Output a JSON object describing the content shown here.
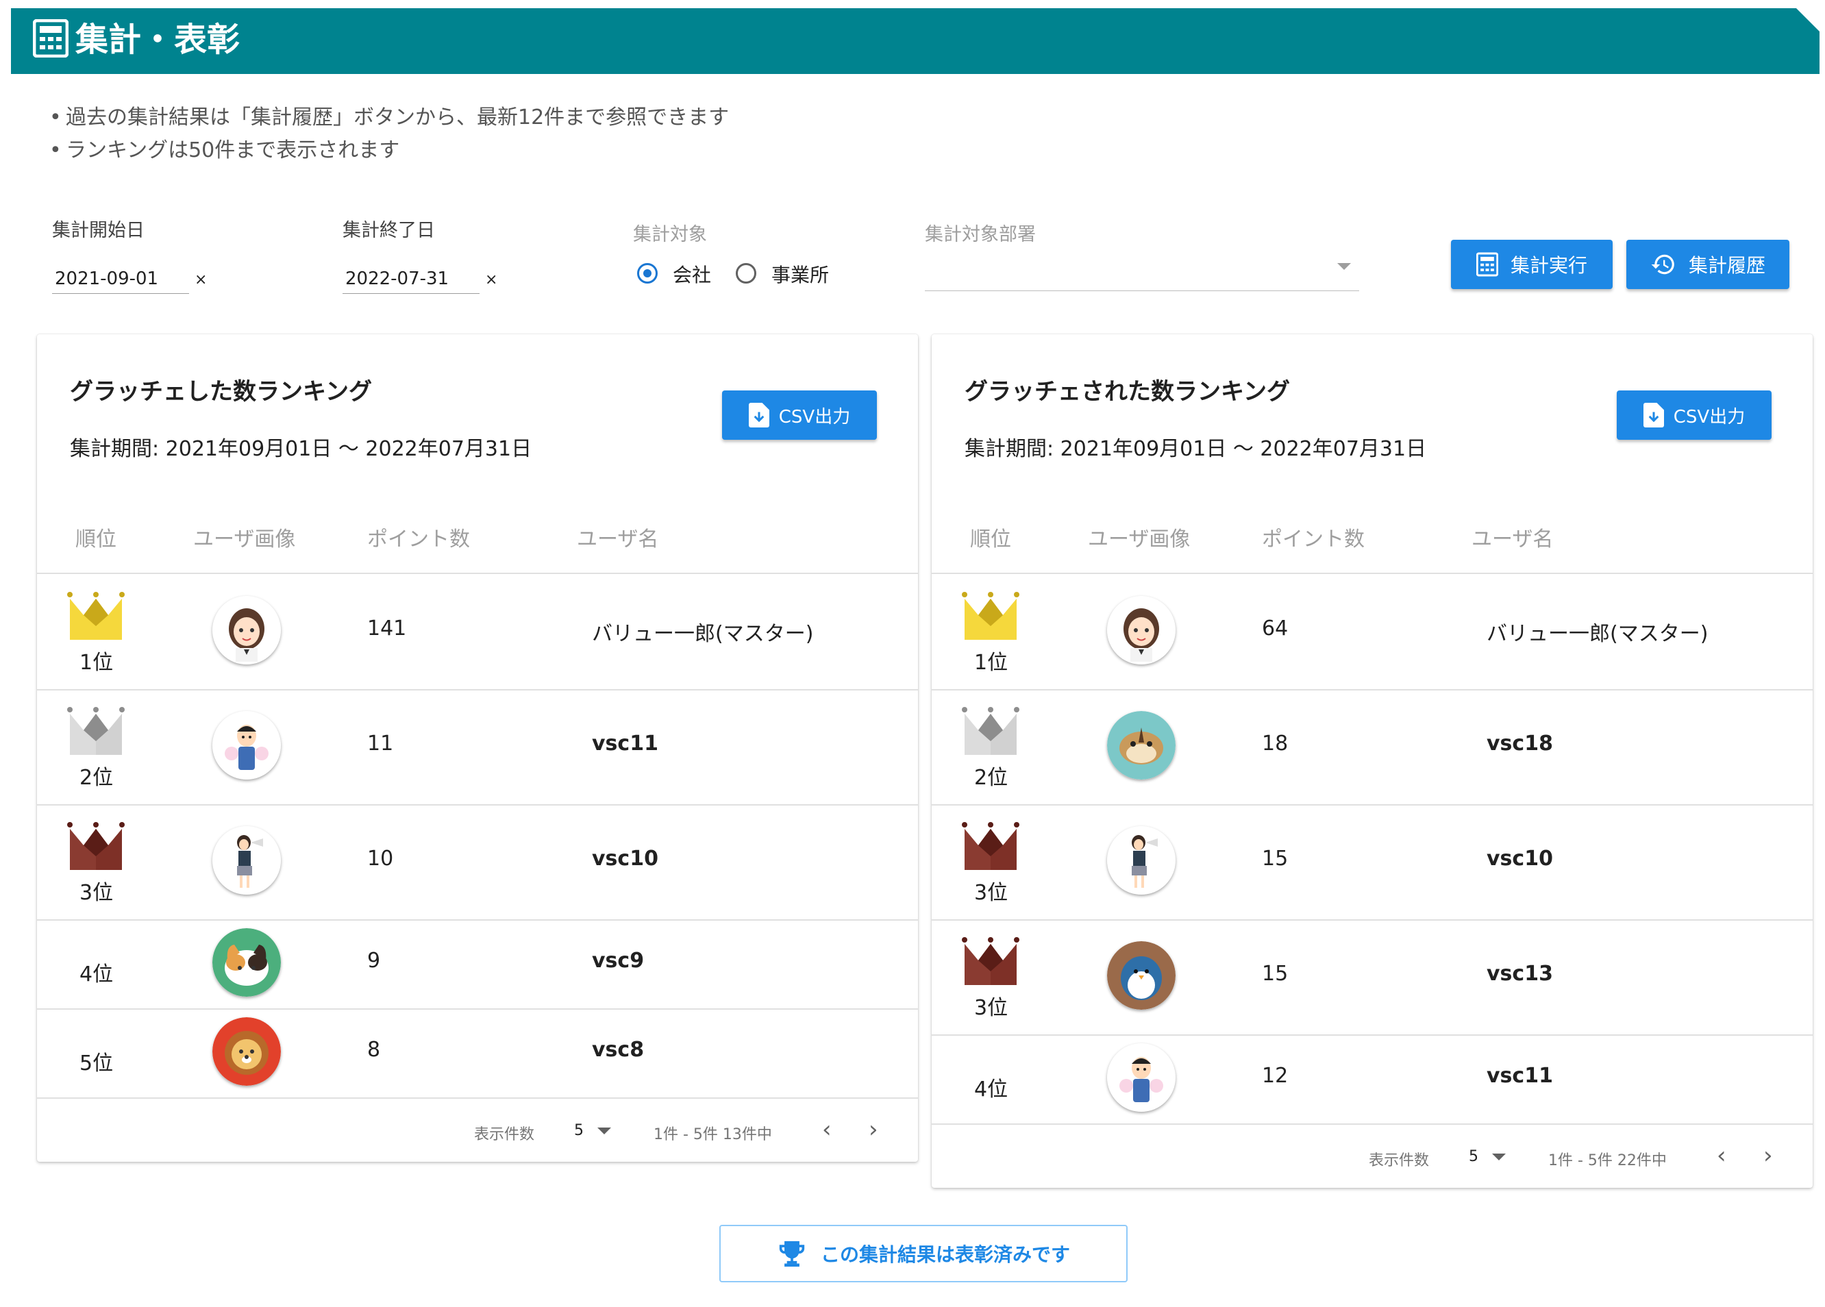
{
  "header": {
    "title": "集計・表彰"
  },
  "notes": [
    "過去の集計結果は「集計履歴」ボタンから、最新12件まで参照できます",
    "ランキングは50件まで表示されます"
  ],
  "form": {
    "start_label": "集計開始日",
    "start_value": "2021-09-01",
    "end_label": "集計終了日",
    "end_value": "2022-07-31",
    "clear_glyph": "×",
    "target_label": "集計対象",
    "target_options": [
      "会社",
      "事業所"
    ],
    "target_selected": "会社",
    "dept_label": "集計対象部署",
    "dept_value": "",
    "run_button": "集計実行",
    "history_button": "集計履歴"
  },
  "left_card": {
    "title": "グラッチェした数ランキング",
    "period": "集計期間: 2021年09月01日 〜 2022年07月31日",
    "csv_button": "CSV出力",
    "columns": [
      "順位",
      "ユーザ画像",
      "ポイント数",
      "ユーザ名"
    ],
    "rows": [
      {
        "rank": "1位",
        "crown": "gold",
        "avatar": "girl-avatar",
        "points": "141",
        "name": "バリュー一郎(マスター)"
      },
      {
        "rank": "2位",
        "crown": "silver",
        "avatar": "boy-avatar",
        "points": "11",
        "name": "vsc11"
      },
      {
        "rank": "3位",
        "crown": "bronze",
        "avatar": "schoolgirl-avatar",
        "points": "10",
        "name": "vsc10"
      },
      {
        "rank": "4位",
        "crown": "none",
        "avatar": "cat-avatar",
        "points": "9",
        "name": "vsc9"
      },
      {
        "rank": "5位",
        "crown": "none",
        "avatar": "lion-avatar",
        "points": "8",
        "name": "vsc8"
      }
    ],
    "footer": {
      "per_page_label": "表示件数",
      "per_page": "5",
      "range": "1件 - 5件 13件中"
    }
  },
  "right_card": {
    "title": "グラッチェされた数ランキング",
    "period": "集計期間: 2021年09月01日 〜 2022年07月31日",
    "csv_button": "CSV出力",
    "columns": [
      "順位",
      "ユーザ画像",
      "ポイント数",
      "ユーザ名"
    ],
    "rows": [
      {
        "rank": "1位",
        "crown": "gold",
        "avatar": "girl-avatar",
        "points": "64",
        "name": "バリュー一郎(マスター)"
      },
      {
        "rank": "2位",
        "crown": "silver",
        "avatar": "chipmunk-avatar",
        "points": "18",
        "name": "vsc18"
      },
      {
        "rank": "3位",
        "crown": "bronze",
        "avatar": "schoolgirl-avatar",
        "points": "15",
        "name": "vsc10"
      },
      {
        "rank": "3位",
        "crown": "bronze",
        "avatar": "penguin-avatar",
        "points": "15",
        "name": "vsc13"
      },
      {
        "rank": "4位",
        "crown": "none",
        "avatar": "boy-avatar",
        "points": "12",
        "name": "vsc11"
      }
    ],
    "footer": {
      "per_page_label": "表示件数",
      "per_page": "5",
      "range": "1件 - 5件 22件中"
    }
  },
  "award_button": "この集計結果は表彰済みです",
  "colors": {
    "header": "#00838f",
    "primary": "#1e88e5",
    "gold": "#f5d83c",
    "silver": "#cfcfcf",
    "bronze": "#7b2f26"
  }
}
